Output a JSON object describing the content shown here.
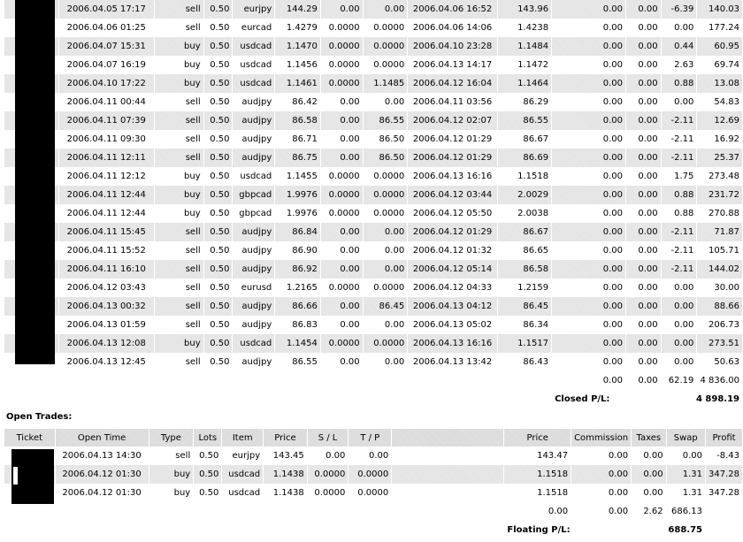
{
  "closed_trades": {
    "rows": [
      {
        "open_time": "2006.04.05 17:17",
        "type": "sell",
        "lots": "0.50",
        "item": "eurjpy",
        "price": "144.29",
        "sl": "0.00",
        "tp": "0.00",
        "close_time": "2006.04.06 16:52",
        "close_price": "143.96",
        "commission": "0.00",
        "taxes": "0.00",
        "swap": "-6.39",
        "profit": "140.03"
      },
      {
        "open_time": "2006.04.06 01:25",
        "type": "sell",
        "lots": "0.50",
        "item": "eurcad",
        "price": "1.4279",
        "sl": "0.0000",
        "tp": "0.0000",
        "close_time": "2006.04.06 14:06",
        "close_price": "1.4238",
        "commission": "0.00",
        "taxes": "0.00",
        "swap": "0.00",
        "profit": "177.24"
      },
      {
        "open_time": "2006.04.07 15:31",
        "type": "buy",
        "lots": "0.50",
        "item": "usdcad",
        "price": "1.1470",
        "sl": "0.0000",
        "tp": "0.0000",
        "close_time": "2006.04.10 23:28",
        "close_price": "1.1484",
        "commission": "0.00",
        "taxes": "0.00",
        "swap": "0.44",
        "profit": "60.95"
      },
      {
        "open_time": "2006.04.07 16:19",
        "type": "buy",
        "lots": "0.50",
        "item": "usdcad",
        "price": "1.1456",
        "sl": "0.0000",
        "tp": "0.0000",
        "close_time": "2006.04.13 14:17",
        "close_price": "1.1472",
        "commission": "0.00",
        "taxes": "0.00",
        "swap": "2.63",
        "profit": "69.74"
      },
      {
        "open_time": "2006.04.10 17:22",
        "type": "buy",
        "lots": "0.50",
        "item": "usdcad",
        "price": "1.1461",
        "sl": "0.0000",
        "tp": "1.1485",
        "close_time": "2006.04.12 16:04",
        "close_price": "1.1464",
        "commission": "0.00",
        "taxes": "0.00",
        "swap": "0.88",
        "profit": "13.08"
      },
      {
        "open_time": "2006.04.11 00:44",
        "type": "sell",
        "lots": "0.50",
        "item": "audjpy",
        "price": "86.42",
        "sl": "0.00",
        "tp": "0.00",
        "close_time": "2006.04.11 03:56",
        "close_price": "86.29",
        "commission": "0.00",
        "taxes": "0.00",
        "swap": "0.00",
        "profit": "54.83"
      },
      {
        "open_time": "2006.04.11 07:39",
        "type": "sell",
        "lots": "0.50",
        "item": "audjpy",
        "price": "86.58",
        "sl": "0.00",
        "tp": "86.55",
        "close_time": "2006.04.12 02:07",
        "close_price": "86.55",
        "commission": "0.00",
        "taxes": "0.00",
        "swap": "-2.11",
        "profit": "12.69"
      },
      {
        "open_time": "2006.04.11 09:30",
        "type": "sell",
        "lots": "0.50",
        "item": "audjpy",
        "price": "86.71",
        "sl": "0.00",
        "tp": "86.50",
        "close_time": "2006.04.12 01:29",
        "close_price": "86.67",
        "commission": "0.00",
        "taxes": "0.00",
        "swap": "-2.11",
        "profit": "16.92"
      },
      {
        "open_time": "2006.04.11 12:11",
        "type": "sell",
        "lots": "0.50",
        "item": "audjpy",
        "price": "86.75",
        "sl": "0.00",
        "tp": "86.50",
        "close_time": "2006.04.12 01:29",
        "close_price": "86.69",
        "commission": "0.00",
        "taxes": "0.00",
        "swap": "-2.11",
        "profit": "25.37"
      },
      {
        "open_time": "2006.04.11 12:12",
        "type": "buy",
        "lots": "0.50",
        "item": "usdcad",
        "price": "1.1455",
        "sl": "0.0000",
        "tp": "0.0000",
        "close_time": "2006.04.13 16:16",
        "close_price": "1.1518",
        "commission": "0.00",
        "taxes": "0.00",
        "swap": "1.75",
        "profit": "273.48"
      },
      {
        "open_time": "2006.04.11 12:44",
        "type": "buy",
        "lots": "0.50",
        "item": "gbpcad",
        "price": "1.9976",
        "sl": "0.0000",
        "tp": "0.0000",
        "close_time": "2006.04.12 03:44",
        "close_price": "2.0029",
        "commission": "0.00",
        "taxes": "0.00",
        "swap": "0.88",
        "profit": "231.72"
      },
      {
        "open_time": "2006.04.11 12:44",
        "type": "buy",
        "lots": "0.50",
        "item": "gbpcad",
        "price": "1.9976",
        "sl": "0.0000",
        "tp": "0.0000",
        "close_time": "2006.04.12 05:50",
        "close_price": "2.0038",
        "commission": "0.00",
        "taxes": "0.00",
        "swap": "0.88",
        "profit": "270.88"
      },
      {
        "open_time": "2006.04.11 15:45",
        "type": "sell",
        "lots": "0.50",
        "item": "audjpy",
        "price": "86.84",
        "sl": "0.00",
        "tp": "0.00",
        "close_time": "2006.04.12 01:29",
        "close_price": "86.67",
        "commission": "0.00",
        "taxes": "0.00",
        "swap": "-2.11",
        "profit": "71.87"
      },
      {
        "open_time": "2006.04.11 15:52",
        "type": "sell",
        "lots": "0.50",
        "item": "audjpy",
        "price": "86.90",
        "sl": "0.00",
        "tp": "0.00",
        "close_time": "2006.04.12 01:32",
        "close_price": "86.65",
        "commission": "0.00",
        "taxes": "0.00",
        "swap": "-2.11",
        "profit": "105.71"
      },
      {
        "open_time": "2006.04.11 16:10",
        "type": "sell",
        "lots": "0.50",
        "item": "audjpy",
        "price": "86.92",
        "sl": "0.00",
        "tp": "0.00",
        "close_time": "2006.04.12 05:14",
        "close_price": "86.58",
        "commission": "0.00",
        "taxes": "0.00",
        "swap": "-2.11",
        "profit": "144.02"
      },
      {
        "open_time": "2006.04.12 03:43",
        "type": "sell",
        "lots": "0.50",
        "item": "eurusd",
        "price": "1.2165",
        "sl": "0.0000",
        "tp": "0.0000",
        "close_time": "2006.04.12 04:33",
        "close_price": "1.2159",
        "commission": "0.00",
        "taxes": "0.00",
        "swap": "0.00",
        "profit": "30.00"
      },
      {
        "open_time": "2006.04.13 00:32",
        "type": "sell",
        "lots": "0.50",
        "item": "audjpy",
        "price": "86.66",
        "sl": "0.00",
        "tp": "86.45",
        "close_time": "2006.04.13 04:12",
        "close_price": "86.45",
        "commission": "0.00",
        "taxes": "0.00",
        "swap": "0.00",
        "profit": "88.66"
      },
      {
        "open_time": "2006.04.13 01:59",
        "type": "sell",
        "lots": "0.50",
        "item": "audjpy",
        "price": "86.83",
        "sl": "0.00",
        "tp": "0.00",
        "close_time": "2006.04.13 05:02",
        "close_price": "86.34",
        "commission": "0.00",
        "taxes": "0.00",
        "swap": "0.00",
        "profit": "206.73"
      },
      {
        "open_time": "2006.04.13 12:08",
        "type": "buy",
        "lots": "0.50",
        "item": "usdcad",
        "price": "1.1454",
        "sl": "0.0000",
        "tp": "0.0000",
        "close_time": "2006.04.13 16:16",
        "close_price": "1.1517",
        "commission": "0.00",
        "taxes": "0.00",
        "swap": "0.00",
        "profit": "273.51"
      },
      {
        "open_time": "2006.04.13 12:45",
        "type": "sell",
        "lots": "0.50",
        "item": "audjpy",
        "price": "86.55",
        "sl": "0.00",
        "tp": "0.00",
        "close_time": "2006.04.13 13:42",
        "close_price": "86.43",
        "commission": "0.00",
        "taxes": "0.00",
        "swap": "0.00",
        "profit": "50.63"
      }
    ],
    "totals": {
      "commission": "0.00",
      "taxes": "0.00",
      "swap": "62.19",
      "profit": "4 836.00"
    },
    "pl_label": "Closed P/L:",
    "pl_value": "4 898.19"
  },
  "open_trades": {
    "title": "Open Trades:",
    "headers": {
      "ticket": "Ticket",
      "open_time": "Open Time",
      "type": "Type",
      "lots": "Lots",
      "item": "Item",
      "price": "Price",
      "sl": "S / L",
      "tp": "T / P",
      "blank": "",
      "cur_price": "Price",
      "commission": "Commission",
      "taxes": "Taxes",
      "swap": "Swap",
      "profit": "Profit"
    },
    "rows": [
      {
        "open_time": "2006.04.13 14:30",
        "type": "sell",
        "lots": "0.50",
        "item": "eurjpy",
        "price": "143.45",
        "sl": "0.00",
        "tp": "0.00",
        "cur_price": "143.47",
        "commission": "0.00",
        "taxes": "0.00",
        "swap": "0.00",
        "profit": "-8.43"
      },
      {
        "open_time": "2006.04.12 01:30",
        "type": "buy",
        "lots": "0.50",
        "item": "usdcad",
        "price": "1.1438",
        "sl": "0.0000",
        "tp": "0.0000",
        "cur_price": "1.1518",
        "commission": "0.00",
        "taxes": "0.00",
        "swap": "1.31",
        "profit": "347.28"
      },
      {
        "open_time": "2006.04.12 01:30",
        "type": "buy",
        "lots": "0.50",
        "item": "usdcad",
        "price": "1.1438",
        "sl": "0.0000",
        "tp": "0.0000",
        "cur_price": "1.1518",
        "commission": "0.00",
        "taxes": "0.00",
        "swap": "1.31",
        "profit": "347.28"
      }
    ],
    "totals": {
      "commission": "0.00",
      "taxes": "0.00",
      "swap": "2.62",
      "profit": "686.13"
    },
    "pl_label": "Floating P/L:",
    "pl_value": "688.75"
  }
}
